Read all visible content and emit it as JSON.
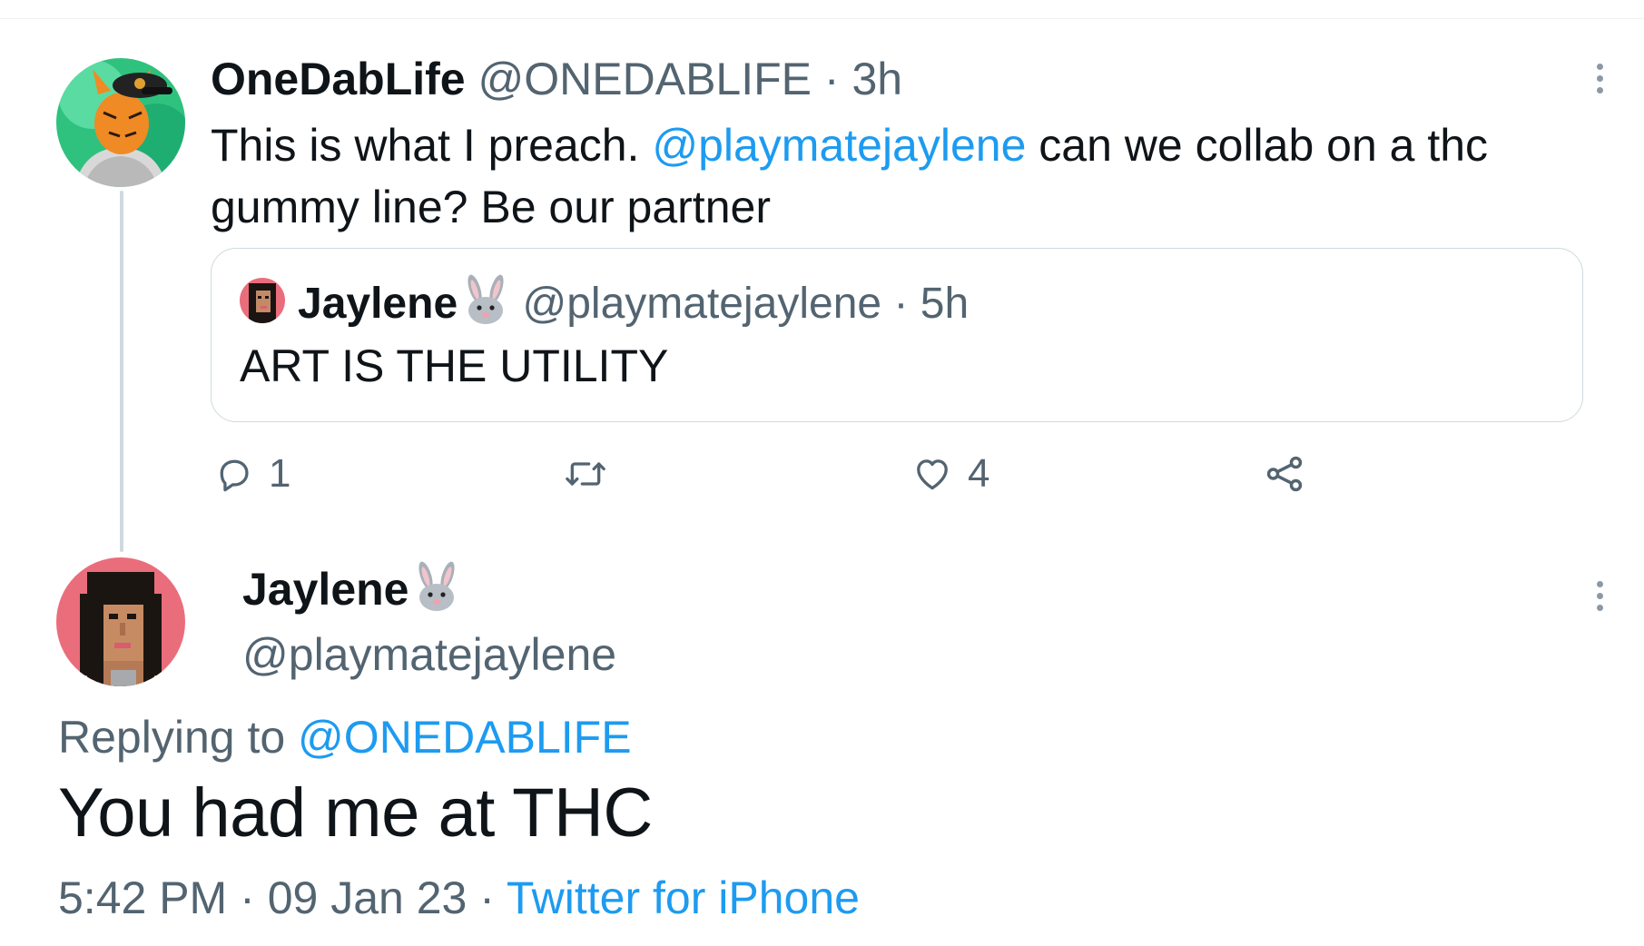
{
  "tweet": {
    "author_name": "OneDabLife",
    "author_handle": "@ONEDABLIFE",
    "separator": "·",
    "time": "3h",
    "text_before": "This is what I preach. ",
    "mention": "@playmatejaylene",
    "text_after": " can we collab on a thc gummy line?  Be our partner",
    "quoted": {
      "author_name": "Jaylene",
      "author_emoji": "rabbit-face-icon",
      "author_handle": "@playmatejaylene",
      "separator": "·",
      "time": "5h",
      "text": "ART IS THE UTILITY"
    },
    "actions": {
      "reply_count": "1",
      "retweet_count": "",
      "like_count": "4",
      "icons": [
        "reply-icon",
        "retweet-icon",
        "like-icon",
        "share-icon"
      ]
    }
  },
  "reply": {
    "author_name": "Jaylene",
    "author_emoji": "rabbit-face-icon",
    "author_handle": "@playmatejaylene",
    "replying_label": "Replying to ",
    "replying_to": "@ONEDABLIFE",
    "text": "You had me at THC",
    "time": "5:42 PM",
    "separator_1": "·",
    "date": "09 Jan 23",
    "separator_2": "·",
    "source": "Twitter for iPhone"
  },
  "colors": {
    "link": "#1d9bf0",
    "text": "#0f1419",
    "muted": "#536471",
    "border": "#cfd9de"
  }
}
